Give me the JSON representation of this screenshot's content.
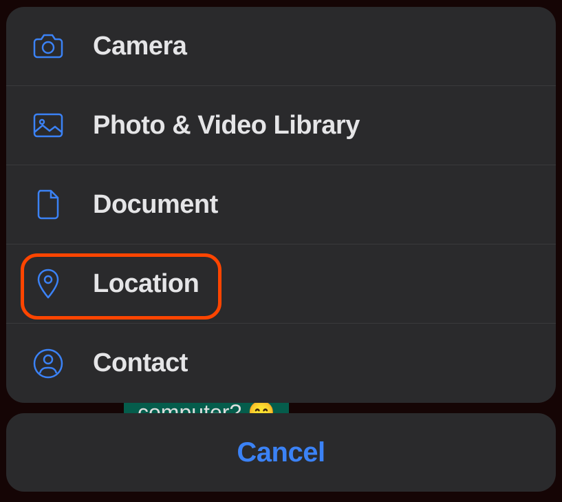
{
  "menu": {
    "items": [
      {
        "label": "Camera",
        "icon": "camera-icon"
      },
      {
        "label": "Photo & Video Library",
        "icon": "photo-icon"
      },
      {
        "label": "Document",
        "icon": "document-icon"
      },
      {
        "label": "Location",
        "icon": "location-icon"
      },
      {
        "label": "Contact",
        "icon": "contact-icon"
      }
    ]
  },
  "cancel": {
    "label": "Cancel"
  },
  "highlighted_item": "Location",
  "colors": {
    "accent": "#3b82f6",
    "highlight": "#ff4500",
    "sheet_bg": "#2a2a2c",
    "text": "#e5e5e7"
  },
  "background_chat_text": "computer? 😄"
}
